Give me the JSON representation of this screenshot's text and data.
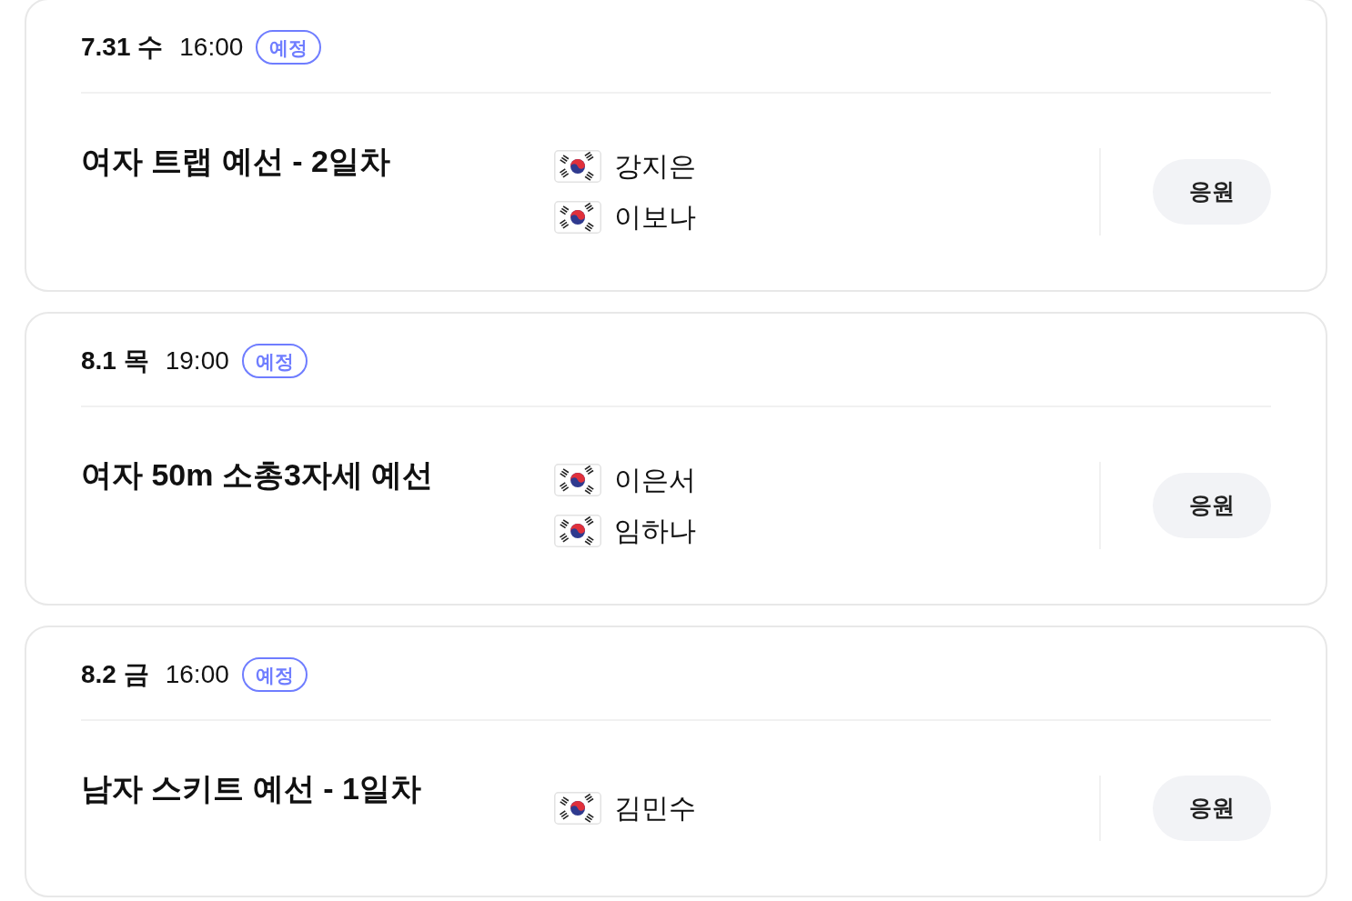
{
  "games": [
    {
      "date": "7.31 수",
      "time": "16:00",
      "status": "예정",
      "title": "여자 트랩 예선 - 2일차",
      "athletes": [
        {
          "name": "강지은"
        },
        {
          "name": "이보나"
        }
      ],
      "button": "응원"
    },
    {
      "date": "8.1 목",
      "time": "19:00",
      "status": "예정",
      "title": "여자 50m 소총3자세 예선",
      "athletes": [
        {
          "name": "이은서"
        },
        {
          "name": "임하나"
        }
      ],
      "button": "응원"
    },
    {
      "date": "8.2 금",
      "time": "16:00",
      "status": "예정",
      "title": "남자 스키트 예선 - 1일차",
      "athletes": [
        {
          "name": "김민수"
        }
      ],
      "button": "응원"
    }
  ]
}
